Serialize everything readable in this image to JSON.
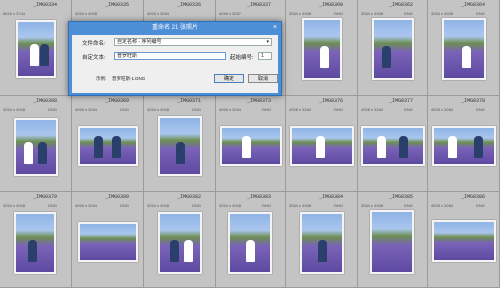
{
  "dialog": {
    "title": "重命名 21 张照片",
    "close_glyph": "×",
    "file_naming_label": "文件命名:",
    "file_naming_value": "自定名称 - 序列编号",
    "custom_text_label": "自定文本:",
    "custom_text_value": "普罗旺斯",
    "start_number_label": "起始编号:",
    "start_number_value": "1",
    "example_label": "示例:",
    "example_value": "普罗旺斯-1.DNG",
    "ok_label": "确定",
    "cancel_label": "取消"
  },
  "cells": [
    {
      "num": "_IMG0334",
      "dims": "5616 x 3744",
      "ext": "DNG"
    },
    {
      "num": "_IMG0335",
      "dims": "3264 x 4928",
      "ext": "DNG"
    },
    {
      "num": "_IMG0336",
      "dims": "4928 x 3264",
      "ext": "DNG"
    },
    {
      "num": "_IMG0337",
      "dims": "4048 x 3037",
      "ext": "DNG"
    },
    {
      "num": "_IMG0360",
      "dims": "3264 x 4928",
      "ext": "DNG"
    },
    {
      "num": "_IMG0362",
      "dims": "3264 x 4928",
      "ext": "DNG"
    },
    {
      "num": "_IMG0364",
      "dims": "3264 x 4928",
      "ext": "DNG"
    },
    {
      "num": "_IMG0368",
      "dims": "3264 x 4928",
      "ext": "DNG"
    },
    {
      "num": "_IMG0369",
      "dims": "4928 x 3264",
      "ext": "DNG"
    },
    {
      "num": "_IMG0371",
      "dims": "3264 x 4928",
      "ext": "DNG"
    },
    {
      "num": "_IMG0373",
      "dims": "4928 x 3264",
      "ext": "DNG"
    },
    {
      "num": "_IMG0376",
      "dims": "4928 x 3264",
      "ext": "DNG"
    },
    {
      "num": "_IMG0377",
      "dims": "4928 x 3264",
      "ext": "DNG"
    },
    {
      "num": "_IMG0378",
      "dims": "4928 x 3264",
      "ext": "DNG"
    },
    {
      "num": "_IMG0379",
      "dims": "3264 x 4928",
      "ext": "DNG"
    },
    {
      "num": "_IMG0380",
      "dims": "4928 x 3264",
      "ext": "DNG"
    },
    {
      "num": "_IMG0382",
      "dims": "3264 x 4928",
      "ext": "DNG"
    },
    {
      "num": "_IMG0383",
      "dims": "3264 x 4928",
      "ext": "DNG"
    },
    {
      "num": "_IMG0384",
      "dims": "3264 x 4928",
      "ext": "DNG"
    },
    {
      "num": "_IMG0385",
      "dims": "3264 x 4928",
      "ext": "DNG"
    },
    {
      "num": "_IMG0386",
      "dims": "4928 x 3264",
      "ext": "DNG"
    }
  ]
}
